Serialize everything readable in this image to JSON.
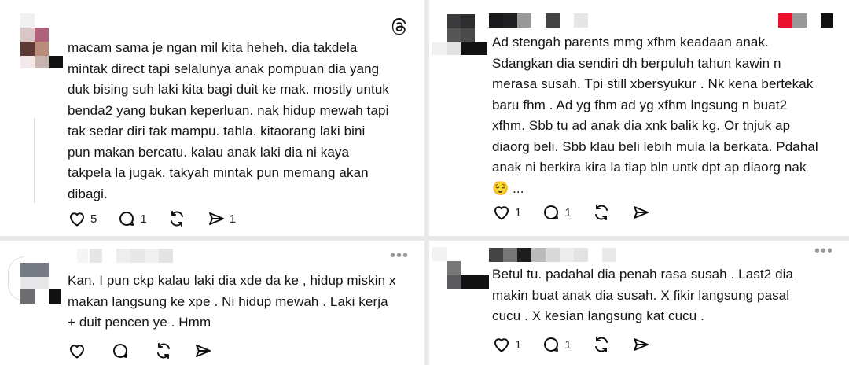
{
  "threads_logo": "threads-logo-icon",
  "comments": [
    {
      "text": "macam sama je ngan mil kita heheh. dia takdela\nmintak direct tapi selalunya anak pompuan dia yang\nduk bising suh laki kita bagi duit ke mak. mostly untuk\nbenda2 yang bukan keperluan. nak hidup mewah tapi\ntak sedar diri tak mampu. tahla. kitaorang laki bini\npun makan bercatu. kalau anak laki dia ni kaya\ntakpela la jugak. takyah mintak pun memang akan\ndibagi.",
      "likes": "5",
      "replies": "1",
      "reposts": "",
      "shares": "1"
    },
    {
      "text": "Kan. I pun ckp kalau laki dia xde da ke , hidup miskin x\nmakan langsung ke xpe . Ni hidup mewah . Laki kerja\n+ duit pencen ye . Hmm",
      "likes": "",
      "replies": "",
      "reposts": "",
      "shares": ""
    },
    {
      "text": "Ad stengah parents mmg xfhm keadaan anak.\nSdangkan dia sendiri dh berpuluh tahun kawin n\nmerasa susah. Tpi still xbersyukur . Nk kena bertekak\nbaru fhm . Ad yg fhm ad yg xfhm lngsung n buat2\nxfhm. Sbb tu ad anak dia xnk balik kg. Or tnjuk ap\ndiaorg beli. Sbb klau beli lebih mula la berkata. Pdahal\nanak ni berkira kira la tiap bln untk dpt ap diaorg nak\n😌 ...",
      "likes": "1",
      "replies": "1",
      "reposts": "",
      "shares": ""
    },
    {
      "text": "Betul tu. padahal dia penah rasa susah . Last2 dia\nmakin buat anak dia susah. X fikir langsung pasal\ncucu . X kesian langsung kat cucu .",
      "likes": "1",
      "replies": "1",
      "reposts": "",
      "shares": ""
    }
  ],
  "more_label": "•••"
}
